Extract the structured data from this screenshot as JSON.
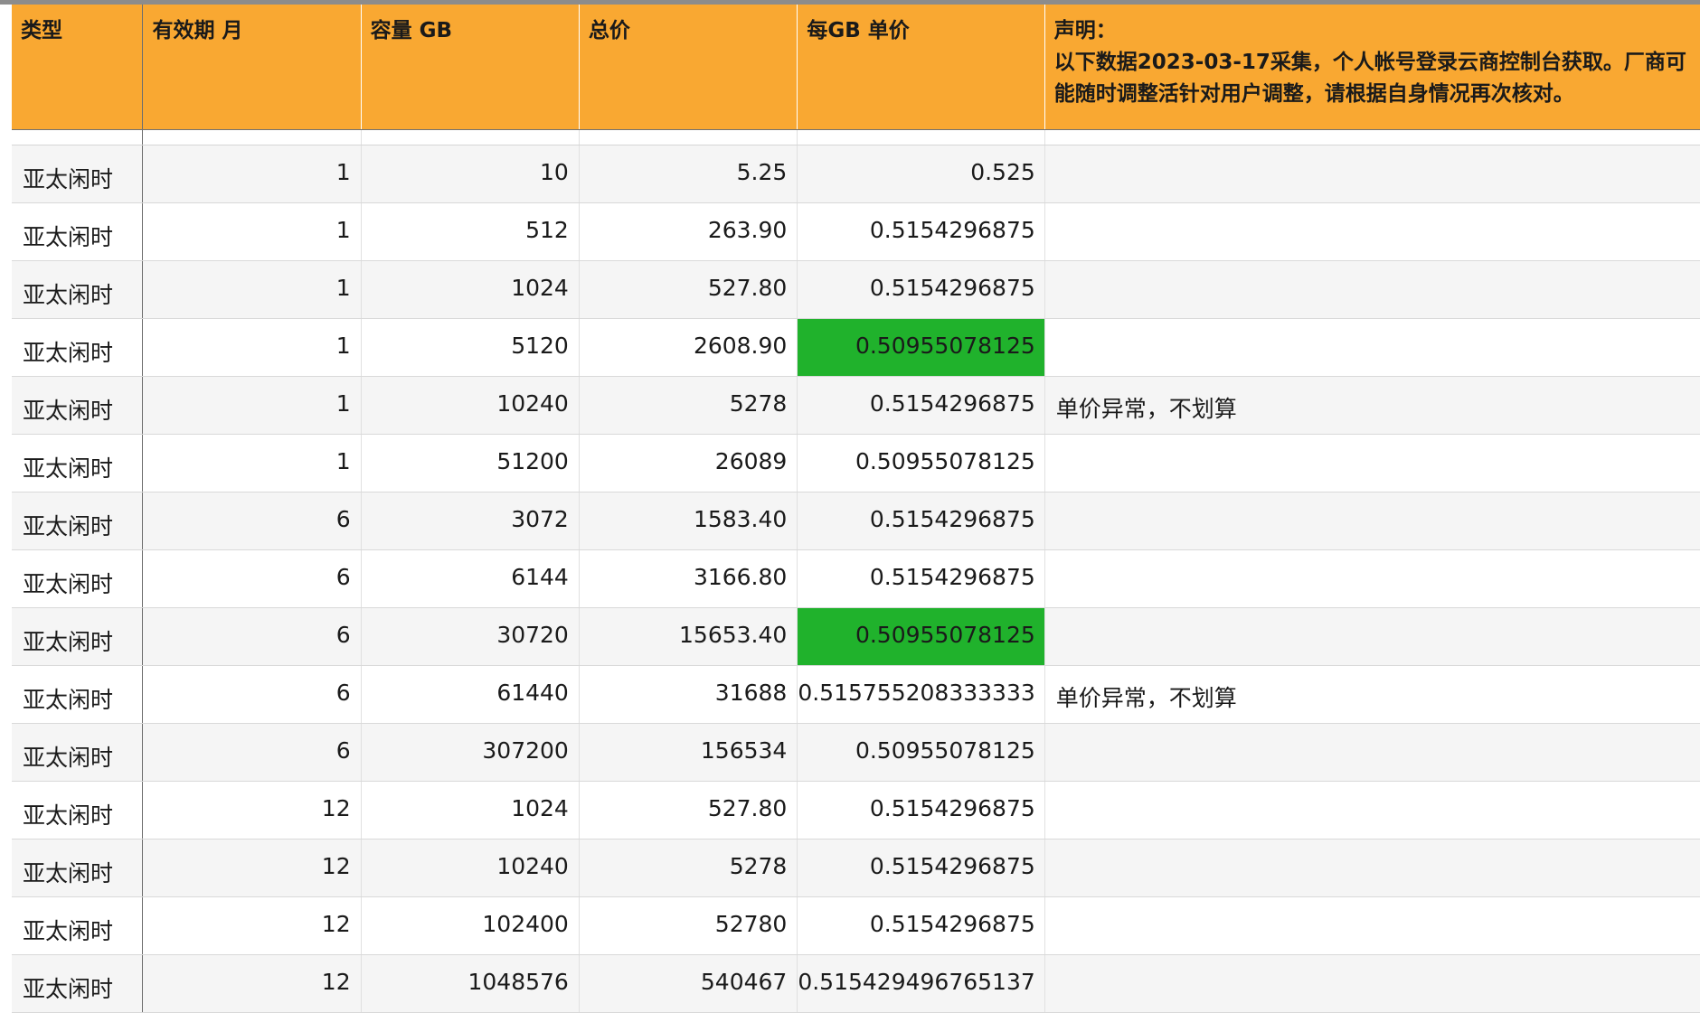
{
  "columns": [
    "类型",
    "有效期  月",
    "容量 GB",
    "总价",
    "每GB 单价",
    "声明：\n以下数据2023-03-17采集，个人帐号登录云商控制台获取。厂商可能随时调整活针对用户调整，请根据自身情况再次核对。"
  ],
  "highlight_color": "#20b22c",
  "header_color": "#f9a832",
  "rows": [
    {
      "type": "亚太闲时",
      "months": "1",
      "capacity": "10",
      "total": "5.25",
      "unit_price": "0.525",
      "note": "",
      "highlight": false
    },
    {
      "type": "亚太闲时",
      "months": "1",
      "capacity": "512",
      "total": "263.90",
      "unit_price": "0.5154296875",
      "note": "",
      "highlight": false
    },
    {
      "type": "亚太闲时",
      "months": "1",
      "capacity": "1024",
      "total": "527.80",
      "unit_price": "0.5154296875",
      "note": "",
      "highlight": false
    },
    {
      "type": "亚太闲时",
      "months": "1",
      "capacity": "5120",
      "total": "2608.90",
      "unit_price": "0.50955078125",
      "note": "",
      "highlight": true
    },
    {
      "type": "亚太闲时",
      "months": "1",
      "capacity": "10240",
      "total": "5278",
      "unit_price": "0.5154296875",
      "note": "单价异常，不划算",
      "highlight": false
    },
    {
      "type": "亚太闲时",
      "months": "1",
      "capacity": "51200",
      "total": "26089",
      "unit_price": "0.50955078125",
      "note": "",
      "highlight": false
    },
    {
      "type": "亚太闲时",
      "months": "6",
      "capacity": "3072",
      "total": "1583.40",
      "unit_price": "0.5154296875",
      "note": "",
      "highlight": false
    },
    {
      "type": "亚太闲时",
      "months": "6",
      "capacity": "6144",
      "total": "3166.80",
      "unit_price": "0.5154296875",
      "note": "",
      "highlight": false
    },
    {
      "type": "亚太闲时",
      "months": "6",
      "capacity": "30720",
      "total": "15653.40",
      "unit_price": "0.50955078125",
      "note": "",
      "highlight": true
    },
    {
      "type": "亚太闲时",
      "months": "6",
      "capacity": "61440",
      "total": "31688",
      "unit_price": "0.515755208333333",
      "note": "单价异常，不划算",
      "highlight": false
    },
    {
      "type": "亚太闲时",
      "months": "6",
      "capacity": "307200",
      "total": "156534",
      "unit_price": "0.50955078125",
      "note": "",
      "highlight": false
    },
    {
      "type": "亚太闲时",
      "months": "12",
      "capacity": "1024",
      "total": "527.80",
      "unit_price": "0.5154296875",
      "note": "",
      "highlight": false
    },
    {
      "type": "亚太闲时",
      "months": "12",
      "capacity": "10240",
      "total": "5278",
      "unit_price": "0.5154296875",
      "note": "",
      "highlight": false
    },
    {
      "type": "亚太闲时",
      "months": "12",
      "capacity": "102400",
      "total": "52780",
      "unit_price": "0.5154296875",
      "note": "",
      "highlight": false
    },
    {
      "type": "亚太闲时",
      "months": "12",
      "capacity": "1048576",
      "total": "540467",
      "unit_price": "0.515429496765137",
      "note": "",
      "highlight": false
    }
  ]
}
